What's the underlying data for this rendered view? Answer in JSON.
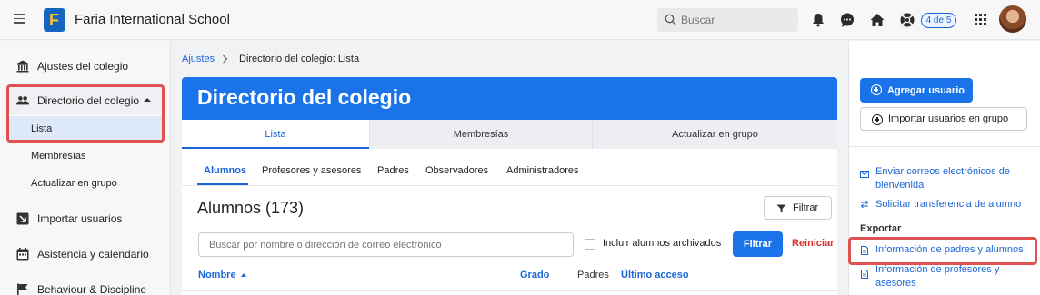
{
  "header": {
    "school_name": "Faria International School",
    "search_placeholder": "Buscar",
    "badge": "4 de 5",
    "icons": [
      "bell-icon",
      "chat-icon",
      "home-icon",
      "help-icon",
      "apps-icon"
    ]
  },
  "sidebar": {
    "items": [
      {
        "label": "Ajustes del colegio",
        "icon": "building-icon"
      },
      {
        "label": "Directorio del colegio",
        "icon": "people-icon"
      },
      {
        "label": "Importar usuarios",
        "icon": "import-icon"
      },
      {
        "label": "Asistencia y calendario",
        "icon": "calendar-icon"
      },
      {
        "label": "Behaviour & Discipline",
        "icon": "flag-icon"
      }
    ],
    "subitems": [
      "Lista",
      "Membresías",
      "Actualizar en grupo"
    ]
  },
  "breadcrumb": {
    "root": "Ajustes",
    "current": "Directorio del colegio: Lista"
  },
  "main": {
    "title": "Directorio del colegio",
    "tabs": [
      "Lista",
      "Membresías",
      "Actualizar en grupo"
    ],
    "subtabs": [
      "Alumnos",
      "Profesores y asesores",
      "Padres",
      "Observadores",
      "Administradores"
    ],
    "list_title": "Alumnos (173)",
    "filter_label": "Filtrar",
    "search_placeholder": "Buscar por nombre o dirección de correo electrónico",
    "archived_label": "Incluir alumnos archivados",
    "apply_label": "Filtrar",
    "reset_label": "Reiniciar",
    "columns": [
      "Nombre",
      "Grado",
      "Padres",
      "Último acceso"
    ]
  },
  "right_panel": {
    "add_user": "Agregar usuario",
    "import_users": "Importar usuarios en grupo",
    "link_welcome_line1": "Enviar correos electrónicos de",
    "link_welcome_line2": "bienvenida",
    "link_transfer": "Solicitar transferencia de alumno",
    "export_heading": "Exportar",
    "export_parents": "Información de padres y alumnos",
    "export_teachers_line1": "Información de profesores y",
    "export_teachers_line2": "asesores"
  },
  "colors": {
    "primary": "#1a73e8",
    "link": "#1a66d6",
    "danger": "#d93025",
    "highlight": "#e05252"
  }
}
